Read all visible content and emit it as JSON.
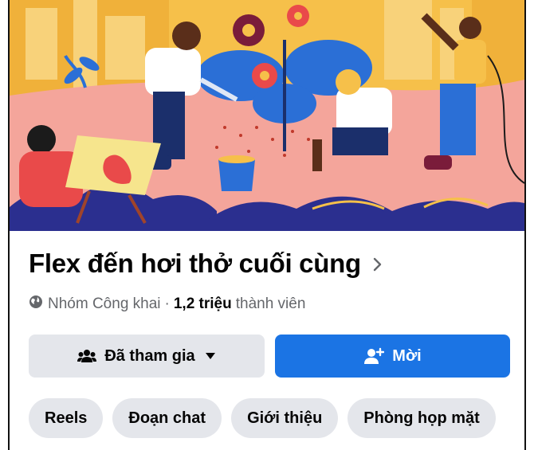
{
  "group": {
    "name": "Flex đến hơi thở cuối cùng",
    "privacy": "Nhóm Công khai",
    "separator": "·",
    "member_count": "1,2 triệu",
    "member_label": "thành viên"
  },
  "actions": {
    "joined_label": "Đã tham gia",
    "invite_label": "Mời"
  },
  "tabs": [
    {
      "label": "Reels"
    },
    {
      "label": "Đoạn chat"
    },
    {
      "label": "Giới thiệu"
    },
    {
      "label": "Phòng họp mặt"
    }
  ],
  "colors": {
    "primary_blue": "#1b74e4",
    "secondary_gray": "#e4e6eb",
    "text_primary": "#050505",
    "text_secondary": "#65676b",
    "cover_pink": "#f4a59b",
    "cover_yellow": "#f6c04a"
  },
  "icons": {
    "title_chevron": "chevron-right-icon",
    "privacy": "globe-icon",
    "joined": "group-members-icon",
    "joined_caret": "caret-down-icon",
    "invite": "add-person-icon"
  }
}
